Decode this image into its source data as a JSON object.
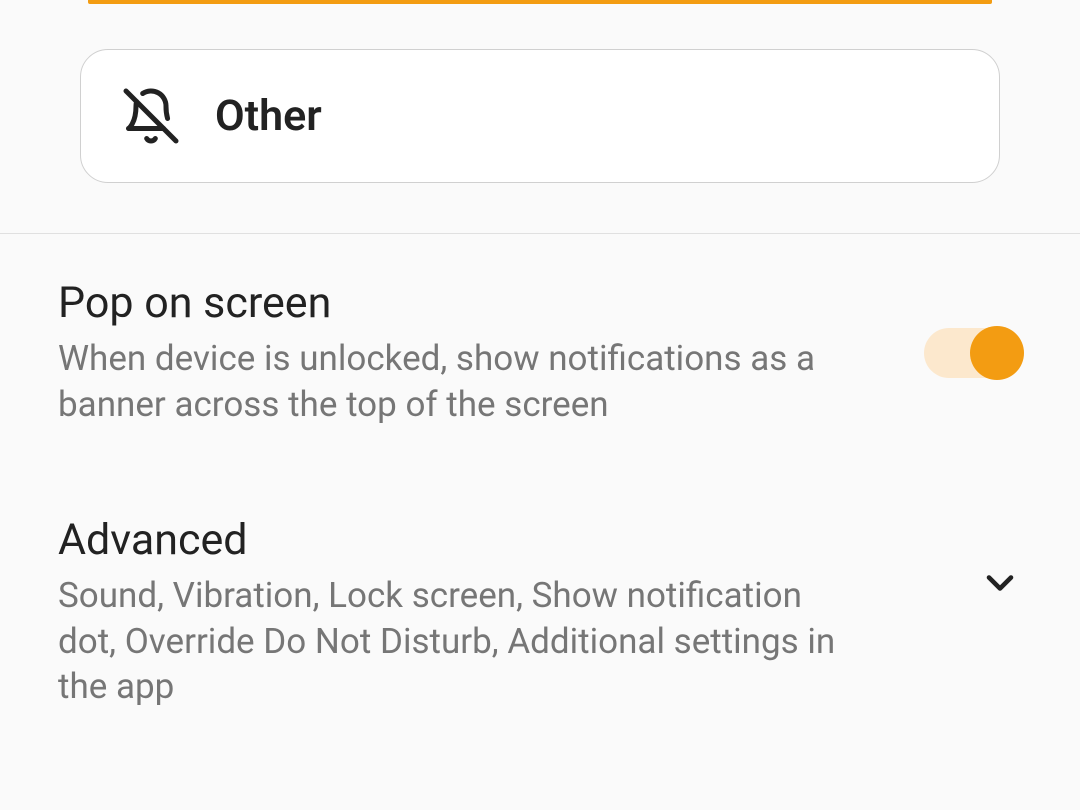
{
  "card": {
    "label": "Other"
  },
  "settings": {
    "pop": {
      "title": "Pop on screen",
      "desc": "When device is unlocked, show notifications as a banner across the top of the screen",
      "enabled": true
    },
    "advanced": {
      "title": "Advanced",
      "desc": "Sound, Vibration, Lock screen, Show notification dot, Override Do Not Disturb, Additional settings in the app"
    }
  },
  "colors": {
    "accent": "#f39c12"
  }
}
